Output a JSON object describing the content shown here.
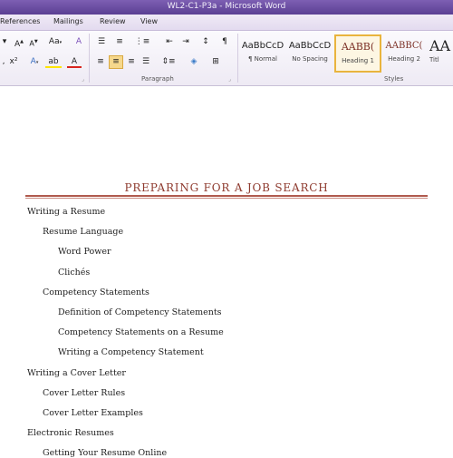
{
  "window": {
    "title": "WL2-C1-P3a - Microsoft Word"
  },
  "tabs": [
    "References",
    "Mailings",
    "Review",
    "View"
  ],
  "ribbon": {
    "font_row1": {
      "grow_font": "A",
      "shrink_font": "A",
      "change_case": "Aa",
      "clear_format": "A"
    },
    "font_row2": {
      "superscript": "x²",
      "text_effects": "A",
      "highlight": "ab",
      "font_color": "A"
    },
    "paragraph_label": "Paragraph",
    "styles_label": "Styles",
    "colors": {
      "highlight": "#ffe400",
      "font_color": "#d8251e",
      "active_border": "#e9b43d"
    },
    "styles": [
      {
        "sample": "AaBbCcD",
        "name": "¶ Normal"
      },
      {
        "sample": "AaBbCcD",
        "name": "No Spacing"
      },
      {
        "sample": "AABB(",
        "name": "Heading 1"
      },
      {
        "sample": "AABBC(",
        "name": "Heading 2"
      },
      {
        "sample": "AA",
        "name": "Titl"
      }
    ],
    "icons": [
      "bullets-icon",
      "numbering-icon",
      "multilevel-list-icon",
      "decrease-indent-icon",
      "increase-indent-icon",
      "sort-icon",
      "show-marks-icon",
      "align-left-icon",
      "align-center-icon",
      "align-right-icon",
      "justify-icon",
      "line-spacing-icon",
      "shading-icon",
      "borders-icon"
    ]
  },
  "document": {
    "heading": "PREPARING FOR A JOB SEARCH",
    "heading_color": "#8e3a2e",
    "items": [
      {
        "text": "Writing a Resume",
        "level": 1
      },
      {
        "text": "Resume Language",
        "level": 2
      },
      {
        "text": "Word Power",
        "level": 3
      },
      {
        "text": "Clichés",
        "level": 3
      },
      {
        "text": "Competency Statements",
        "level": 2
      },
      {
        "text": "Definition of Competency Statements",
        "level": 3
      },
      {
        "text": "Competency Statements on a Resume",
        "level": 3
      },
      {
        "text": "Writing a Competency Statement",
        "level": 3
      },
      {
        "text": "Writing a Cover Letter",
        "level": 1
      },
      {
        "text": "Cover Letter Rules",
        "level": 2
      },
      {
        "text": "Cover Letter Examples",
        "level": 2
      },
      {
        "text": "Electronic Resumes",
        "level": 1
      },
      {
        "text": "Getting Your Resume Online",
        "level": 2
      }
    ]
  }
}
